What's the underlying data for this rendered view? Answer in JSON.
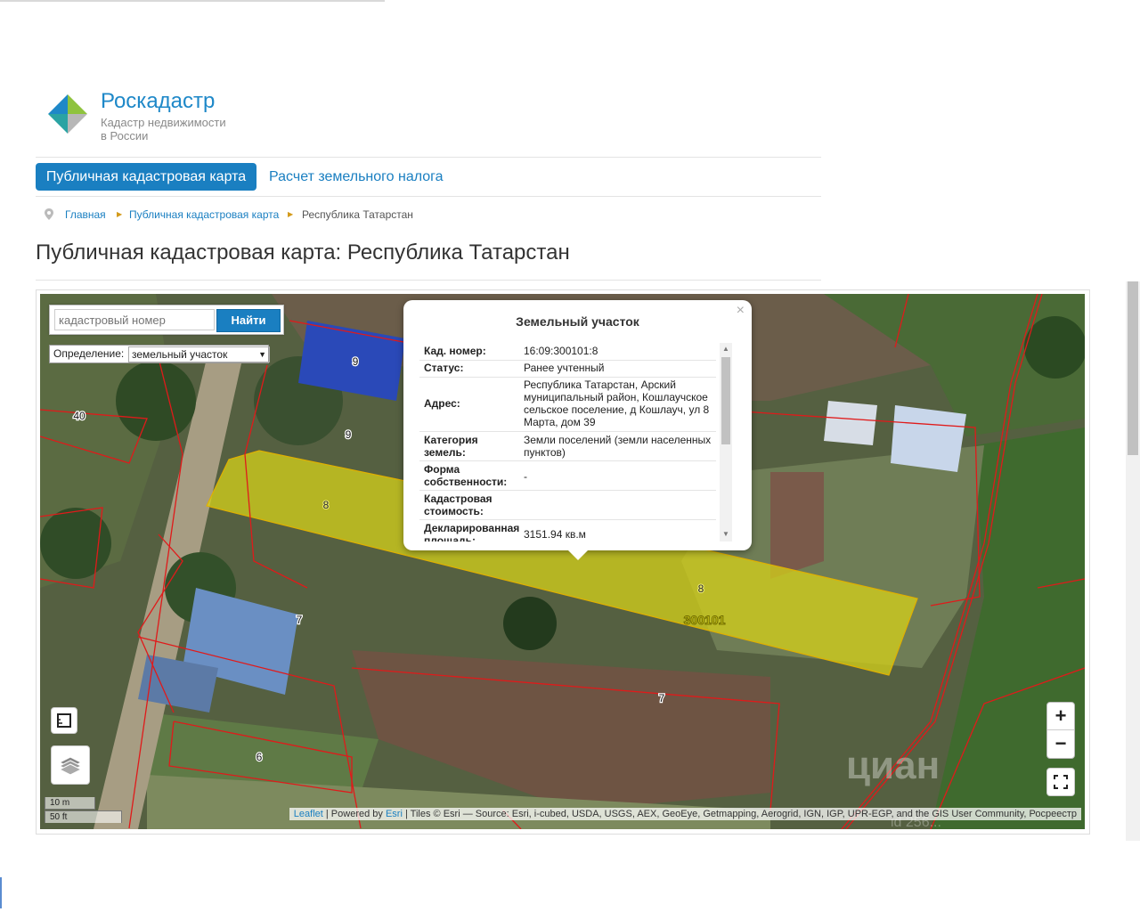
{
  "brand": {
    "name": "Роскадастр",
    "tagline_line1": "Кадастр недвижимости",
    "tagline_line2": "в России"
  },
  "nav": {
    "active_tab": "Публичная кадастровая карта",
    "tab2": "Расчет земельного налога"
  },
  "breadcrumb": {
    "home": "Главная",
    "level2": "Публичная кадастровая карта",
    "current": "Республика Татарстан"
  },
  "page_title": "Публичная кадастровая карта: Республика Татарстан",
  "search": {
    "placeholder": "кадастровый номер",
    "button": "Найти"
  },
  "definition": {
    "label": "Определение:",
    "value": "земельный участок"
  },
  "popup": {
    "title": "Земельный участок",
    "rows": [
      {
        "k": "Кад. номер:",
        "v": "16:09:300101:8"
      },
      {
        "k": "Статус:",
        "v": "Ранее учтенный"
      },
      {
        "k": "Адрес:",
        "v": "Республика Татарстан, Арский муниципальный район, Кошлаучское сельское поселение, д Кошлауч, ул 8 Марта, дом 39"
      },
      {
        "k": "Категория земель:",
        "v": "Земли поселений (земли населенных пунктов)"
      },
      {
        "k": "Форма собственности:",
        "v": "-"
      },
      {
        "k": "Кадастровая стоимость:",
        "v": ""
      },
      {
        "k": "Декларированная площадь:",
        "v": "3151.94 кв.м"
      }
    ]
  },
  "map_labels": {
    "p9a": "9",
    "p9b": "9",
    "p40": "40",
    "p8a": "8",
    "p8b": "8",
    "quarter": "300101",
    "p7a": "7",
    "p7b": "7",
    "p6": "6"
  },
  "controls": {
    "zoom_in": "+",
    "zoom_out": "−"
  },
  "scale": {
    "metric": "10 m",
    "imperial": "50 ft"
  },
  "attribution": {
    "leaflet": "Leaflet",
    "powered": " | Powered by ",
    "esri": "Esri",
    "tiles": " | Tiles © Esri — Source: Esri, i-cubed, USDA, USGS, AEX, GeoEye, Getmapping, Aerogrid, IGN, IGP, UPR-EGP, and the GIS User Community, Росреестр"
  },
  "watermark": {
    "brand": "циан",
    "id": "id 256..."
  },
  "colors": {
    "accent": "#1a7fc1",
    "parcel_fill": "#d6d21a",
    "boundary": "#e01a1a"
  }
}
